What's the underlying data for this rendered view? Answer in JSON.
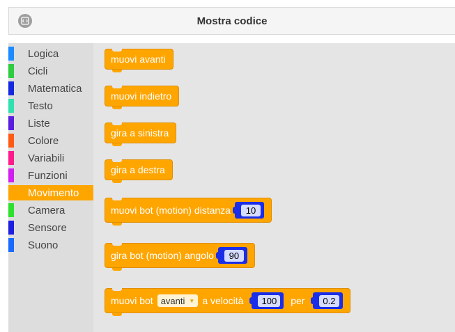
{
  "header": {
    "title": "Mostra codice",
    "button_icon": "code-icon"
  },
  "toolbox": {
    "categories": [
      {
        "label": "Logica",
        "color": "#1a8cff"
      },
      {
        "label": "Cicli",
        "color": "#2ecc40"
      },
      {
        "label": "Matematica",
        "color": "#1428e0"
      },
      {
        "label": "Testo",
        "color": "#2fe0b0"
      },
      {
        "label": "Liste",
        "color": "#5a1ee0"
      },
      {
        "label": "Colore",
        "color": "#ff5a14"
      },
      {
        "label": "Variabili",
        "color": "#ff1a8c"
      },
      {
        "label": "Funzioni",
        "color": "#d21ef0"
      },
      {
        "label": "Movimento",
        "color": "#ffa500",
        "selected": true
      },
      {
        "label": "Camera",
        "color": "#2ee02e"
      },
      {
        "label": "Sensore",
        "color": "#1e1ee0"
      },
      {
        "label": "Suono",
        "color": "#1a6aff"
      }
    ]
  },
  "blocks": {
    "b1": "muovi avanti",
    "b2": "muovi indietro",
    "b3": "gira a sinistra",
    "b4": "gira a destra",
    "b5": {
      "label": "muovi bot (motion) distanza",
      "value": "10"
    },
    "b6": {
      "label": "gira bot (motion) angolo",
      "value": "90"
    },
    "b7": {
      "label1": "muovi bot",
      "dropdown": "avanti",
      "label2": "a velocità",
      "value1": "100",
      "label3": "per",
      "value2": "0.2"
    }
  },
  "colors": {
    "movement": "#ffa500",
    "number_slot": "#1a2ee8"
  }
}
